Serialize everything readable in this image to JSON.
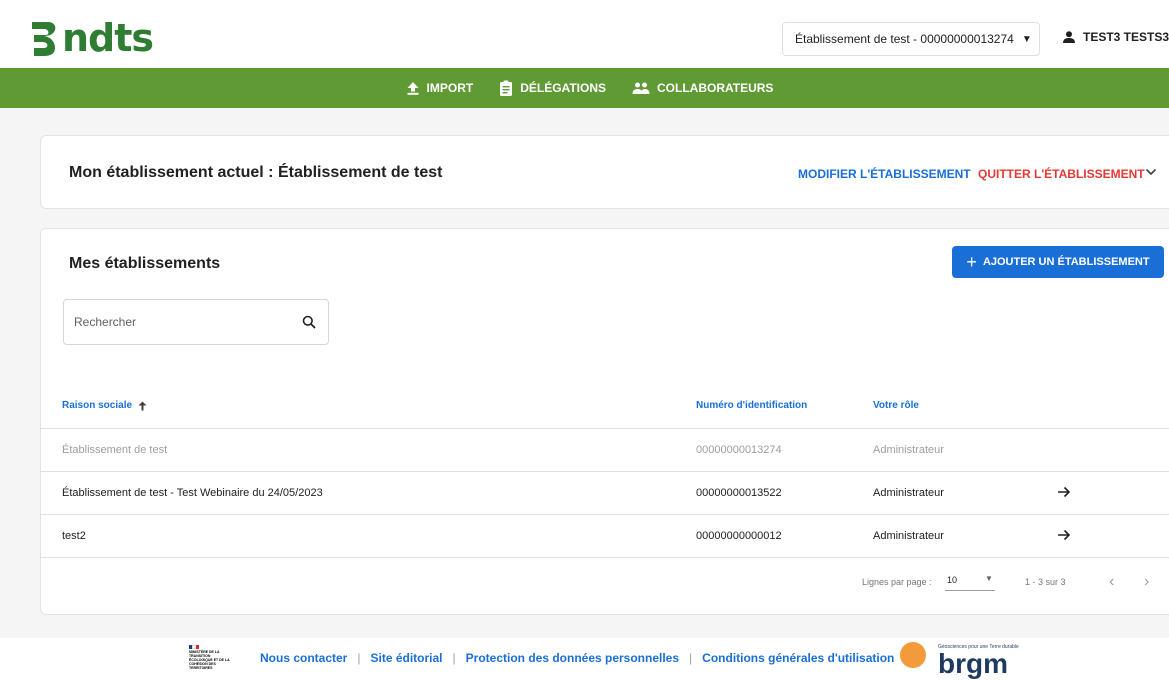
{
  "header": {
    "logo_text": "ndts",
    "establishment_select": "Établissement de test - 00000000013274",
    "user_name": "TEST3 TESTS3"
  },
  "nav": {
    "items": [
      {
        "label": "IMPORT",
        "icon": "upload-icon"
      },
      {
        "label": "DÉLÉGATIONS",
        "icon": "clipboard-icon"
      },
      {
        "label": "COLLABORATEURS",
        "icon": "people-icon"
      }
    ]
  },
  "current": {
    "title": "Mon établissement actuel : Établissement de test",
    "modify_label": "MODIFIER L'ÉTABLISSEMENT",
    "quit_label": "QUITTER L'ÉTABLISSEMENT"
  },
  "list": {
    "title": "Mes établissements",
    "add_label": "AJOUTER UN ÉTABLISSEMENT",
    "search_placeholder": "Rechercher",
    "columns": [
      "Raison sociale",
      "Numéro d'identification",
      "Votre rôle"
    ],
    "rows": [
      {
        "name": "Établissement de test",
        "id": "00000000013274",
        "role": "Administrateur",
        "current": true
      },
      {
        "name": "Établissement de test - Test Webinaire du 24/05/2023",
        "id": "00000000013522",
        "role": "Administrateur",
        "current": false
      },
      {
        "name": "test2",
        "id": "00000000000012",
        "role": "Administrateur",
        "current": false
      }
    ],
    "pagination": {
      "rows_per_page_label": "Lignes par page :",
      "rows_per_page": "10",
      "range": "1 - 3 sur 3"
    }
  },
  "footer": {
    "ministry_text": "MINISTÈRE DE LA TRANSITION ÉCOLOGIQUE ET DE LA COHÉSION DES TERRITOIRES",
    "links": [
      "Nous contacter",
      "Site éditorial",
      "Protection des données personnelles",
      "Conditions générales d'utilisation"
    ],
    "brgm_tagline": "Géosciences pour une Terre durable",
    "brgm_name": "brgm"
  },
  "colors": {
    "brand_green": "#5f9a35",
    "logo_green": "#2e7d32",
    "primary_blue": "#1a6fd6",
    "danger_red": "#e53935",
    "brgm_navy": "#1f3a5f",
    "brgm_orange": "#f39a3b"
  }
}
